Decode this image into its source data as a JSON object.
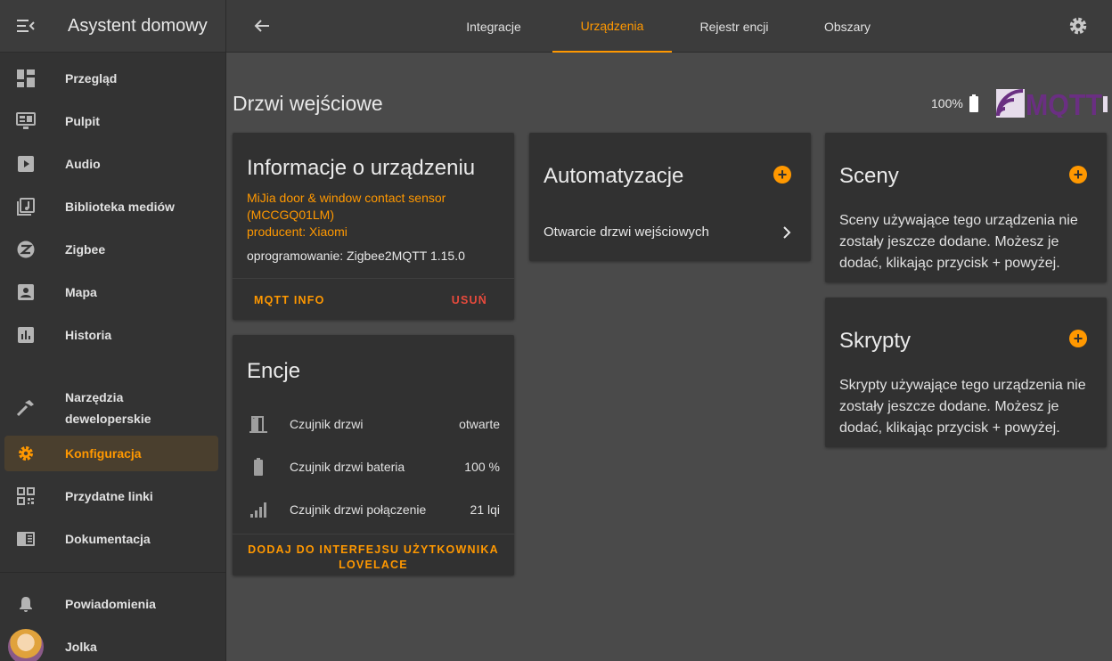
{
  "sidebar": {
    "title": "Asystent domowy",
    "items": [
      {
        "label": "Przegląd",
        "icon": "dashboard-icon"
      },
      {
        "label": "Pulpit",
        "icon": "monitor-dashboard-icon"
      },
      {
        "label": "Audio",
        "icon": "play-box-icon"
      },
      {
        "label": "Biblioteka mediów",
        "icon": "media-library-icon"
      },
      {
        "label": "Zigbee",
        "icon": "zigbee-icon"
      },
      {
        "label": "Mapa",
        "icon": "account-box-icon"
      },
      {
        "label": "Historia",
        "icon": "chart-box-icon"
      },
      {
        "label": "Narzędzia",
        "label2": "deweloperskie",
        "icon": "hammer-icon"
      },
      {
        "label": "Konfiguracja",
        "icon": "gear-icon",
        "active": true
      },
      {
        "label": "Przydatne linki",
        "icon": "qrcode-icon"
      },
      {
        "label": "Dokumentacja",
        "icon": "book-icon"
      }
    ],
    "notifications": "Powiadomienia",
    "user": "Jolka"
  },
  "topbar": {
    "tabs": [
      "Integracje",
      "Urządzenia",
      "Rejestr encji",
      "Obszary"
    ],
    "active_tab": "Urządzenia"
  },
  "device": {
    "title": "Drzwi wejściowe",
    "battery": "100%"
  },
  "info_card": {
    "title": "Informacje o urządzeniu",
    "model_line1": "MiJia door & window contact sensor",
    "model_line2": "(MCCGQ01LM)",
    "manufacturer": "producent: Xiaomi",
    "firmware": "oprogramowanie: Zigbee2MQTT 1.15.0",
    "mqtt_info": "MQTT INFO",
    "delete": "USUŃ"
  },
  "entities_card": {
    "title": "Encje",
    "rows": [
      {
        "name": "Czujnik drzwi",
        "value": "otwarte",
        "icon": "door-open-icon"
      },
      {
        "name": "Czujnik drzwi bateria",
        "value": "100 %",
        "icon": "battery-icon"
      },
      {
        "name": "Czujnik drzwi połączenie",
        "value": "21 lqi",
        "icon": "signal-icon"
      }
    ],
    "add_line1": "DODAJ DO INTERFEJSU UŻYTKOWNIKA",
    "add_line2": "LOVELACE"
  },
  "automations_card": {
    "title": "Automatyzacje",
    "item": "Otwarcie drzwi wejściowych"
  },
  "scenes_card": {
    "title": "Sceny",
    "desc_line1": "Sceny używające tego urządzenia nie",
    "desc_line2": "zostały jeszcze dodane. Możesz je",
    "desc_line3": "dodać, klikając przycisk + powyżej."
  },
  "scripts_card": {
    "title": "Skrypty",
    "desc_line1": "Skrypty używające tego urządzenia nie",
    "desc_line2": "zostały jeszcze dodane. Możesz je",
    "desc_line3": "dodać, klikając przycisk + powyżej."
  },
  "colors": {
    "accent": "#ff9800",
    "danger": "#e84a3c",
    "card": "#313131",
    "background": "#4a4a4a"
  }
}
